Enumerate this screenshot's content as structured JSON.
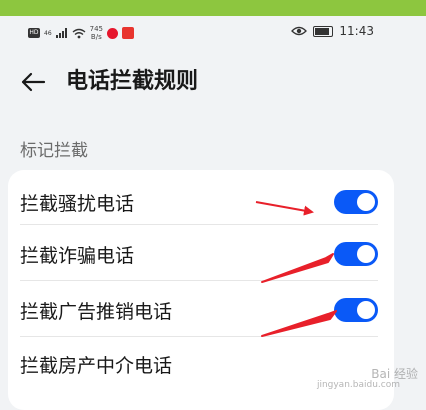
{
  "status_bar": {
    "hd_badge": "HD",
    "signal_text": "46",
    "speed_value": "745",
    "speed_unit": "B/s",
    "time": "11:43"
  },
  "header": {
    "title": "电话拦截规则",
    "back_icon": "arrow-left-icon"
  },
  "section": {
    "label": "标记拦截"
  },
  "rules": [
    {
      "label": "拦截骚扰电话",
      "enabled": true
    },
    {
      "label": "拦截诈骗电话",
      "enabled": true
    },
    {
      "label": "拦截广告推销电话",
      "enabled": true
    },
    {
      "label": "拦截房产中介电话",
      "enabled": false
    }
  ],
  "watermark": {
    "text": "Bai 经验",
    "sub": "jingyan.baidu.com"
  },
  "colors": {
    "accent": "#0a59f7",
    "top_band": "#8dc63f",
    "annotation_arrow": "#e8202a"
  }
}
